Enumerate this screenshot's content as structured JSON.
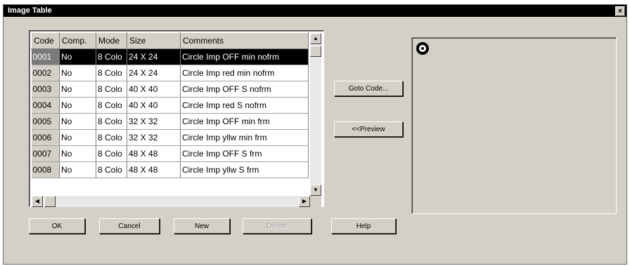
{
  "window": {
    "title": "Image Table",
    "close_glyph": "×"
  },
  "grid": {
    "columns": [
      "Code",
      "Comp.",
      "Mode",
      "Size",
      "Comments"
    ],
    "rows": [
      [
        "0001",
        "No",
        "8 Colo",
        "24 X 24",
        "Circle Imp OFF min nofrm"
      ],
      [
        "0002",
        "No",
        "8 Colo",
        "24 X 24",
        "Circle Imp red min nofrm"
      ],
      [
        "0003",
        "No",
        "8 Colo",
        "40 X 40",
        "Circle Imp OFF S nofrm"
      ],
      [
        "0004",
        "No",
        "8 Colo",
        "40 X 40",
        "Circle Imp red S nofrm"
      ],
      [
        "0005",
        "No",
        "8 Colo",
        "32 X 32",
        "Circle Imp OFF min frm"
      ],
      [
        "0006",
        "No",
        "8 Colo",
        "32 X 32",
        "Circle Imp yllw min frm"
      ],
      [
        "0007",
        "No",
        "8 Colo",
        "48 X 48",
        "Circle Imp OFF S frm"
      ],
      [
        "0008",
        "No",
        "8 Colo",
        "48 X 48",
        "Circle Imp yllw S frm"
      ]
    ],
    "selected_row": 0
  },
  "buttons": {
    "goto_code": "Goto Code...",
    "preview": "<<Preview",
    "ok": "OK",
    "cancel": "Cancel",
    "new": "New",
    "delete": "Delete",
    "help": "Help"
  },
  "scroll": {
    "up": "▲",
    "down": "▼",
    "left": "◀",
    "right": "▶"
  },
  "icons": {
    "preview_image": "circle-lamp-icon"
  }
}
